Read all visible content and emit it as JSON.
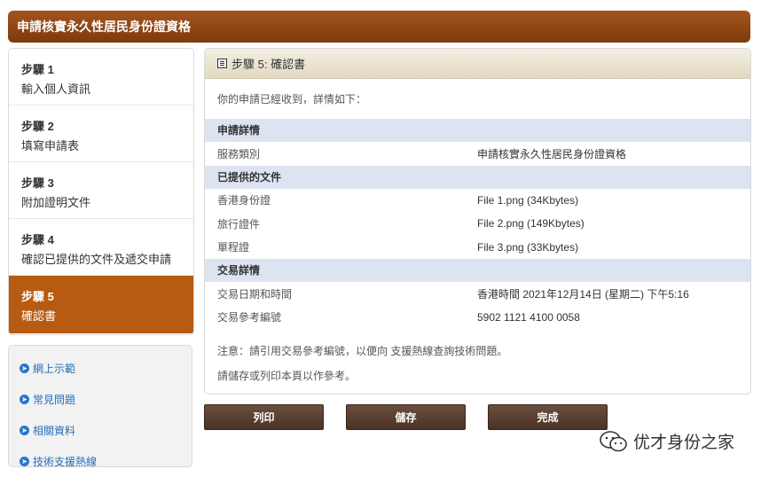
{
  "header": {
    "title": "申請核實永久性居民身份證資格"
  },
  "steps": [
    {
      "num": "步驟 1",
      "desc": "輸入個人資訊"
    },
    {
      "num": "步驟 2",
      "desc": "填寫申請表"
    },
    {
      "num": "步驟 3",
      "desc": "附加證明文件"
    },
    {
      "num": "步驟 4",
      "desc": "確認已提供的文件及遞交申請"
    },
    {
      "num": "步驟 5",
      "desc": "確認書"
    }
  ],
  "links": [
    {
      "label": "網上示範"
    },
    {
      "label": "常見問題"
    },
    {
      "label": "相關資料"
    },
    {
      "label": "技術支援熱線"
    }
  ],
  "panel": {
    "title": "步驟 5: 確認書",
    "intro": "你的申請已經收到，詳情如下：",
    "sections": [
      {
        "title": "申請詳情",
        "rows": [
          {
            "k": "服務類別",
            "v": "申請核實永久性居民身份證資格"
          }
        ]
      },
      {
        "title": "已提供的文件",
        "rows": [
          {
            "k": "香港身份證",
            "v": "File 1.png (34Kbytes)"
          },
          {
            "k": "旅行證件",
            "v": "File 2.png (149Kbytes)"
          },
          {
            "k": "單程證",
            "v": "File 3.png (33Kbytes)"
          }
        ]
      },
      {
        "title": "交易詳情",
        "rows": [
          {
            "k": "交易日期和時間",
            "v": "香港時間 2021年12月14日 (星期二) 下午5:16"
          },
          {
            "k": "交易參考編號",
            "v": "5902 1121 4100 0058"
          }
        ]
      }
    ],
    "note1": "注意：請引用交易參考編號，以便向 支援熱線查詢技術問題。",
    "note2": "請儲存或列印本頁以作參考。"
  },
  "buttons": {
    "print": "列印",
    "save": "儲存",
    "done": "完成"
  },
  "watermark": {
    "text": "优才身份之家",
    "icon": "wechat-icon"
  }
}
